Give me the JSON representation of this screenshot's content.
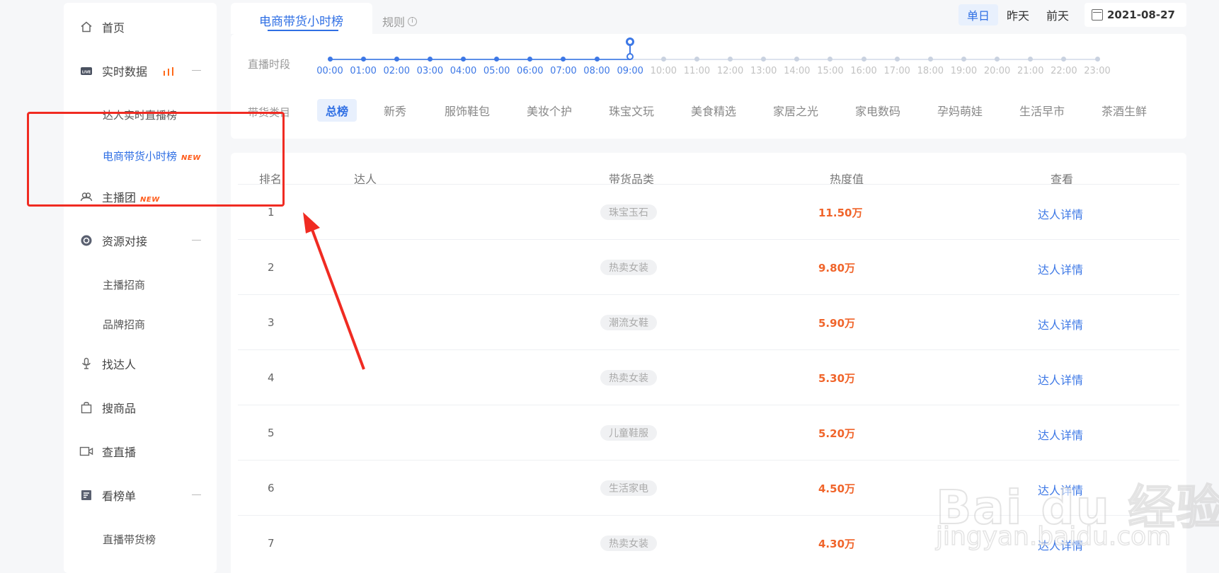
{
  "sidebar": {
    "items": [
      {
        "label": "首页",
        "icon": "home-icon"
      },
      {
        "label": "实时数据",
        "icon": "live-icon"
      },
      {
        "label": "达人实时直播榜"
      },
      {
        "label": "电商带货小时榜",
        "badge": "NEW"
      },
      {
        "label": "主播团",
        "icon": "group-icon",
        "badge": "NEW"
      },
      {
        "label": "资源对接",
        "icon": "resource-icon"
      },
      {
        "label": "主播招商"
      },
      {
        "label": "品牌招商"
      },
      {
        "label": "找达人",
        "icon": "microphone-icon"
      },
      {
        "label": "搜商品",
        "icon": "bag-icon"
      },
      {
        "label": "查直播",
        "icon": "video-icon"
      },
      {
        "label": "看榜单",
        "icon": "list-icon"
      },
      {
        "label": "直播带货榜"
      }
    ]
  },
  "tabs": {
    "active": "电商带货小时榜",
    "rules": "规则",
    "rules_info_glyph": "i"
  },
  "day_switch": {
    "options": [
      "单日",
      "昨天",
      "前天"
    ],
    "selected": "单日"
  },
  "date": "2021-08-27",
  "filters": {
    "time_label": "直播时段",
    "category_label": "带货类目",
    "time_slots": [
      "00:00",
      "01:00",
      "02:00",
      "03:00",
      "04:00",
      "05:00",
      "06:00",
      "07:00",
      "08:00",
      "09:00",
      "10:00",
      "11:00",
      "12:00",
      "13:00",
      "14:00",
      "15:00",
      "16:00",
      "17:00",
      "18:00",
      "19:00",
      "20:00",
      "21:00",
      "22:00",
      "23:00"
    ],
    "current_slot_index": 9,
    "categories": [
      "总榜",
      "新秀",
      "服饰鞋包",
      "美妆个护",
      "珠宝文玩",
      "美食精选",
      "家居之光",
      "家电数码",
      "孕妈萌娃",
      "生活早市",
      "茶酒生鲜"
    ],
    "selected_category": "总榜"
  },
  "table": {
    "headers": {
      "rank": "排名",
      "talent": "达人",
      "category": "带货品类",
      "heat": "热度值",
      "view": "查看"
    },
    "rows": [
      {
        "rank": "1",
        "category": "珠宝玉石",
        "heat": "11.50万",
        "view": "达人详情"
      },
      {
        "rank": "2",
        "category": "热卖女装",
        "heat": "9.80万",
        "view": "达人详情"
      },
      {
        "rank": "3",
        "category": "潮流女鞋",
        "heat": "5.90万",
        "view": "达人详情"
      },
      {
        "rank": "4",
        "category": "热卖女装",
        "heat": "5.30万",
        "view": "达人详情"
      },
      {
        "rank": "5",
        "category": "儿童鞋服",
        "heat": "5.20万",
        "view": "达人详情"
      },
      {
        "rank": "6",
        "category": "生活家电",
        "heat": "4.50万",
        "view": "达人详情"
      },
      {
        "rank": "7",
        "category": "热卖女装",
        "heat": "4.30万",
        "view": "达人详情"
      }
    ]
  },
  "watermark": {
    "main": "Bai du 经验",
    "sub": "jingyan.baidu.com"
  },
  "colors": {
    "accent": "#2f6fe4",
    "heat": "#f0642a",
    "annotation": "#f02b22",
    "new_badge": "#ff5b1a"
  }
}
